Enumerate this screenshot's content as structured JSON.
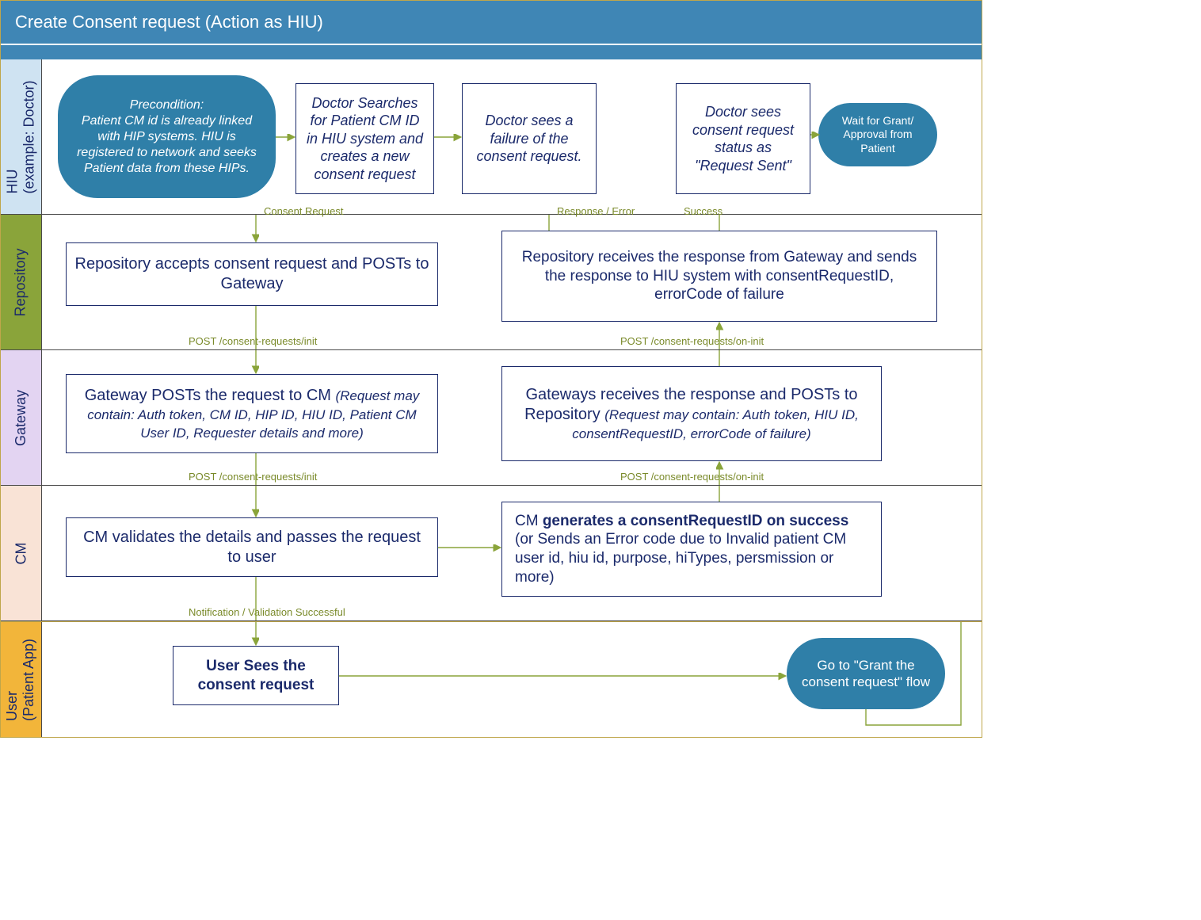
{
  "title": "Create Consent request (Action as HIU)",
  "lanes": {
    "hiu": "HIU\n(example: Doctor)",
    "repo": "Repository",
    "gw": "Gateway",
    "cm": "CM",
    "user": "User\n(Patient App)"
  },
  "nodes": {
    "precondition": "Precondition:\nPatient CM id is already linked with HIP systems. HIU is registered to network and seeks Patient data from these HIPs.",
    "hiu_search": "Doctor Searches for Patient CM ID in HIU system and creates a new consent request",
    "hiu_fail": "Doctor sees a failure of the consent request.",
    "hiu_sent": "Doctor sees consent request status as \"Request Sent\"",
    "hiu_wait": "Wait for Grant/ Approval from Patient",
    "repo_post": "Repository accepts consent request and POSTs to Gateway",
    "repo_recv": "Repository receives the response from Gateway and sends the response to HIU system with consentRequestID,  errorCode of failure",
    "gw_post_main": "Gateway POSTs the request to CM  ",
    "gw_post_sub": "(Request may contain: Auth token, CM ID, HIP ID, HIU ID, Patient CM User ID, Requester details and more)",
    "gw_recv_main": "Gateways receives the response and POSTs to Repository ",
    "gw_recv_sub": "(Request may contain: Auth token, HIU ID, consentRequestID, errorCode of failure)",
    "cm_validate": "CM validates the details and passes the request to user",
    "cm_gen_pre": "CM ",
    "cm_gen_bold": "generates a consentRequestID on success",
    "cm_gen_rest": " (or Sends an Error code due to Invalid patient CM user id, hiu id, purpose, hiTypes,  persmission or more)",
    "user_sees": "User Sees the consent request",
    "user_goto": "Go to \"Grant the consent request\" flow"
  },
  "edgeLabels": {
    "consent_req": "Consent Request",
    "post_init_1": "POST /consent-requests/init",
    "post_init_2": "POST /consent-requests/init",
    "notif": "Notification / Validation Successful",
    "post_oninit_1": "POST /consent-requests/on-init",
    "post_oninit_2": "POST /consent-requests/on-init",
    "resp_err": "Response / Error",
    "success": "Success"
  }
}
